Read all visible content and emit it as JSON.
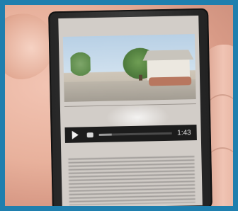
{
  "video_player": {
    "time_label": "1:43",
    "progress": 0.18
  },
  "icons": {
    "play": "play-icon",
    "volume": "volume-icon"
  },
  "colors": {
    "frame": "#1f7fae",
    "player_bar": "#1c1c1c"
  }
}
